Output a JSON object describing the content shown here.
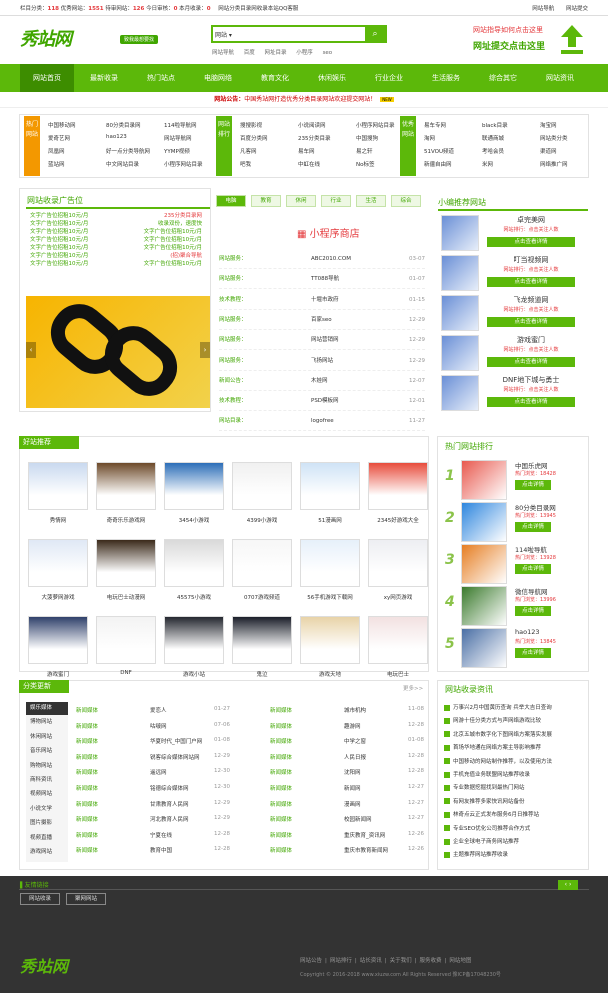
{
  "topbar": {
    "stats": [
      {
        "label": "栏目分类：",
        "value": "118"
      },
      {
        "label": "优秀网站：",
        "value": "1551"
      },
      {
        "label": "待审网站：",
        "value": "126"
      },
      {
        "label": "今日审核：",
        "value": "0"
      },
      {
        "label": "本月收录：",
        "value": "0"
      }
    ],
    "tagline": "网站分类目录网收录本站QQ客服",
    "links": [
      "网站导航",
      "网站提交"
    ]
  },
  "logo": {
    "text": "秀站网",
    "badge": "致我最想要找"
  },
  "search": {
    "scope": "网站",
    "button": "search",
    "hotwords": [
      "网站导航",
      "百度",
      "网址目录",
      "小程序",
      "seo"
    ]
  },
  "submit": {
    "line1": "网站指导如何点击这里",
    "line2": "网址提交点击这里"
  },
  "nav": [
    "网站首页",
    "最新收录",
    "热门站点",
    "电脑网络",
    "教育文化",
    "休闲娱乐",
    "行业企业",
    "生活服务",
    "综合其它",
    "网站资讯"
  ],
  "notice": {
    "label": "网站公告：",
    "text": "中国秀站网打造优秀分类目录网站欢迎提交网站！"
  },
  "catbox": {
    "groups": [
      {
        "tab": "热门网站",
        "cells": [
          "中国移动网",
          "80分类目录网",
          "114啦导航网",
          "爱奇艺网",
          "hao123",
          "网站导航网",
          "凤凰网",
          "好一点分类导航网",
          "YYMP视频",
          "蓝站网",
          "中文网站目录",
          "小程序网站目录"
        ]
      },
      {
        "tab": "网站排行",
        "cells": [
          "搜搜影视",
          "小说阅读网",
          "小程序网站目录",
          "百度分类网",
          "235分类目录",
          "中国搜狗",
          "凡客网",
          "易车网",
          "易之轩",
          "吧我",
          "中虹在线",
          "No标签"
        ]
      },
      {
        "tab": "优秀网站",
        "cells": [
          "易车专网",
          "black目录",
          "淘宝网",
          "淘网",
          "联通商城",
          "网站类分类",
          "51VOU频道",
          "考哈会员",
          "渠道网",
          "新疆自由网",
          "米网",
          "网络推广网"
        ]
      }
    ]
  },
  "adbox": {
    "title": "网站收录广告位",
    "rows": [
      [
        "文字广告位招租10元/月",
        "235分类目录网"
      ],
      [
        "文字广告位招租10元/月",
        "收录双份，速度快"
      ],
      [
        "文字广告位招租10元/月",
        "文字广告位招租10元/月"
      ],
      [
        "文字广告位招租10元/月",
        "文字广告位招租10元/月"
      ],
      [
        "文字广告位招租10元/月",
        "文字广告位招租10元/月"
      ],
      [
        "文字广告位招租10元/月",
        "(招)聚合导航"
      ],
      [
        "文字广告位招租10元/月",
        "文字广告位招租10元/月"
      ]
    ]
  },
  "tabs": [
    "电脑",
    "教育",
    "休闲",
    "行业",
    "生活",
    "综合"
  ],
  "mini_title": "小程序商店",
  "latest": [
    {
      "c": "网站服务：",
      "n": "ABC2010.COM",
      "d": "03-07"
    },
    {
      "c": "网站服务：",
      "n": "TT088导航",
      "d": "01-07"
    },
    {
      "c": "技术教程：",
      "n": "十堰市政府",
      "d": "01-15"
    },
    {
      "c": "网站服务：",
      "n": "百家seo",
      "d": "12-29"
    },
    {
      "c": "网站服务：",
      "n": "网站营销网",
      "d": "12-29"
    },
    {
      "c": "网站服务：",
      "n": "飞扬网站",
      "d": "12-29"
    },
    {
      "c": "新闻公告：",
      "n": "木娃网",
      "d": "12-07"
    },
    {
      "c": "技术教程：",
      "n": "PSD模板网",
      "d": "12-01"
    },
    {
      "c": "网站目录：",
      "n": "logofree",
      "d": "11-27"
    },
    {
      "c": "网站目录：",
      "n": "好网址123",
      "d": "11-18"
    }
  ],
  "recommend": {
    "title": "小编推荐网站",
    "items": [
      {
        "name": "卓完美网",
        "info": "网站排行：点击关注人数",
        "btn": "点击查看详情"
      },
      {
        "name": "叮当视频网",
        "info": "网站排行：点击关注人数",
        "btn": "点击查看详情"
      },
      {
        "name": "飞龙频道网",
        "info": "网站排行：点击关注人数",
        "btn": "点击查看详情"
      },
      {
        "name": "游戏蜜门",
        "info": "网站排行：点击关注人数",
        "btn": "点击查看详情"
      },
      {
        "name": "DNF地下城与勇士",
        "info": "网站排行：点击关注人数",
        "btn": "点击查看详情"
      }
    ]
  },
  "good_sites": {
    "title": "好站推荐",
    "items": [
      "秀情网",
      "奇奇乐乐游戏网",
      "3454小游戏",
      "4399小游戏",
      "51漫画网",
      "2345好游戏大全",
      "大菠萝网游戏",
      "电玩巴士动漫网",
      "45575小游戏",
      "0707游戏频道",
      "56手机游戏下载网",
      "xy网页游戏",
      "游戏蜜门",
      "DNF",
      "游戏小站",
      "鬼泣",
      "游戏天地",
      "电玩巴士"
    ]
  },
  "hot_rank": {
    "title": "热门网站排行",
    "items": [
      {
        "num": "1",
        "name": "中国乐虎网",
        "info": "热门浏览：18428",
        "btn": "点击详情"
      },
      {
        "num": "2",
        "name": "80分类目录网",
        "info": "热门浏览：13945",
        "btn": "点击详情"
      },
      {
        "num": "3",
        "name": "114啦导航",
        "info": "热门浏览：13928",
        "btn": "点击详情"
      },
      {
        "num": "4",
        "name": "微信导航网",
        "info": "热门浏览：13996",
        "btn": "点击详情"
      },
      {
        "num": "5",
        "name": "hao123",
        "info": "热门浏览：13845",
        "btn": "点击详情"
      }
    ]
  },
  "updates": {
    "title": "分类更新",
    "more": "更多>>",
    "side": [
      "娱乐媒体",
      "博物网站",
      "休闲网站",
      "音乐网站",
      "购物网站",
      "商科资讯",
      "视频网站",
      "小说文学",
      "图片摄影",
      "视频直播",
      "游戏网站"
    ],
    "left": [
      {
        "c": "新闻媒体",
        "n": "爱恋人",
        "d": "01-27"
      },
      {
        "c": "新闻媒体",
        "n": "咕啵网",
        "d": "07-06"
      },
      {
        "c": "新闻媒体",
        "n": "华夏时代_中国门户网",
        "d": "01-08"
      },
      {
        "c": "新闻媒体",
        "n": "锐客综合媒体网站网",
        "d": "12-29"
      },
      {
        "c": "新闻媒体",
        "n": "遥远网",
        "d": "12-30"
      },
      {
        "c": "新闻媒体",
        "n": "铭德综合媒体网",
        "d": "12-30"
      },
      {
        "c": "新闻媒体",
        "n": "甘肃教育人民网",
        "d": "12-29"
      },
      {
        "c": "新闻媒体",
        "n": "河北教育人民网",
        "d": "12-29"
      },
      {
        "c": "新闻媒体",
        "n": "宁夏在线",
        "d": "12-28"
      },
      {
        "c": "新闻媒体",
        "n": "教育中国",
        "d": "12-28"
      }
    ],
    "right": [
      {
        "c": "新闻媒体",
        "n": "城市机构",
        "d": "11-08"
      },
      {
        "c": "新闻媒体",
        "n": "趣游网",
        "d": "12-28"
      },
      {
        "c": "新闻媒体",
        "n": "中学之窗",
        "d": "01-08"
      },
      {
        "c": "新闻媒体",
        "n": "人民日报",
        "d": "12-28"
      },
      {
        "c": "新闻媒体",
        "n": "沈阳网",
        "d": "12-28"
      },
      {
        "c": "新闻媒体",
        "n": "新闻网",
        "d": "12-27"
      },
      {
        "c": "新闻媒体",
        "n": "漫画网",
        "d": "12-27"
      },
      {
        "c": "新闻媒体",
        "n": "校园新闻网",
        "d": "12-27"
      },
      {
        "c": "新闻媒体",
        "n": "重庆教育_资讯网",
        "d": "12-26"
      },
      {
        "c": "新闻媒体",
        "n": "重庆市教育新闻网",
        "d": "12-26"
      }
    ]
  },
  "news": {
    "title": "网站收录资讯",
    "items": [
      "万事兴2月中国黄历查询 兵举大吉日查询",
      "网游十佳分类方式与声网络游戏比较",
      "北京五城市数字化下图网络方案落实发展",
      "首场华地通在网络方案主导影响推荐",
      "中国移动的网站制作推荐，以及使用方法",
      "手机充值业务联盟网站推荐收录",
      "专业数据挖掘找到最热门网站",
      "有网友推荐多家快讯网站备份",
      "林奇点云正式发布服务6月日推荐站",
      "专业SEO优化公司推荐合作方式",
      "企业全球电子商务网站推荐",
      "主题推荐网站推荐收录"
    ]
  },
  "friend_links": {
    "title": "友情链接",
    "items": [
      "网站收录",
      "聚网网站"
    ]
  },
  "footer": {
    "logo": "秀站网",
    "nav": [
      "网站公告",
      "网站排行",
      "站长资讯",
      "关于我们",
      "服务收费",
      "网站地图"
    ],
    "copy": "Copyright © 2016-2018 www.xiuzw.com All Rights Reserved 豫ICP备17048230号"
  }
}
